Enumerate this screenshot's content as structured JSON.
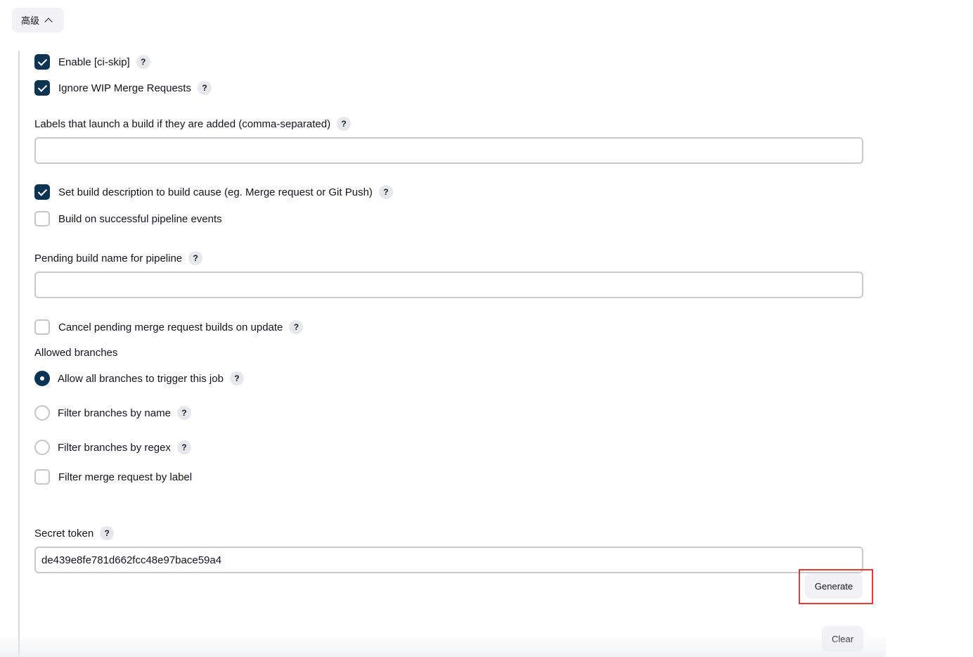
{
  "advanced": {
    "label": "高级"
  },
  "options": {
    "ci_skip": {
      "label": "Enable [ci-skip]",
      "checked": true
    },
    "ignore_wip": {
      "label": "Ignore WIP Merge Requests",
      "checked": true
    },
    "labels_launch": {
      "label": "Labels that launch a build if they are added (comma-separated)",
      "value": ""
    },
    "set_description": {
      "label": "Set build description to build cause (eg. Merge request or Git Push)",
      "checked": true
    },
    "pipeline_events": {
      "label": "Build on successful pipeline events",
      "checked": false
    },
    "pending_build_name": {
      "label": "Pending build name for pipeline",
      "value": ""
    },
    "cancel_pending": {
      "label": "Cancel pending merge request builds on update",
      "checked": false
    }
  },
  "allowed_branches": {
    "heading": "Allowed branches",
    "choices": [
      {
        "label": "Allow all branches to trigger this job",
        "selected": true
      },
      {
        "label": "Filter branches by name",
        "selected": false
      },
      {
        "label": "Filter branches by regex",
        "selected": false
      }
    ],
    "filter_label": {
      "label": "Filter merge request by label",
      "checked": false
    }
  },
  "secret_token": {
    "label": "Secret token",
    "value": "de439e8fe781d662fcc48e97bace59a4",
    "generate_label": "Generate",
    "clear_label": "Clear"
  },
  "help_glyph": "?",
  "colors": {
    "checked": "#0b3352",
    "highlight": "#e33a3a",
    "button_bg": "#f2f2f4"
  }
}
